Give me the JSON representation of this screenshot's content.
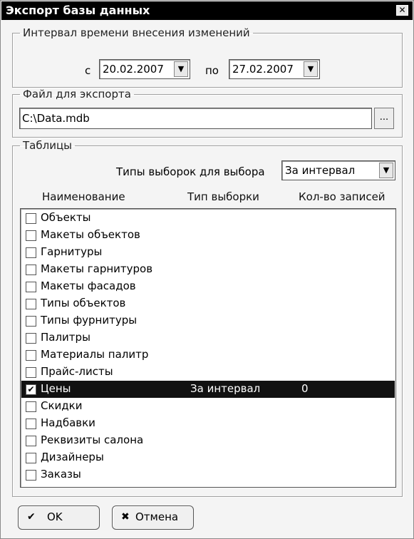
{
  "window": {
    "title": "Экспорт базы данных",
    "close_icon": "close-icon"
  },
  "interval": {
    "legend": "Интервал времени внесения изменений",
    "from_label": "с",
    "from_value": "20.02.2007",
    "to_label": "по",
    "to_value": "27.02.2007"
  },
  "export_file": {
    "legend": "Файл для экспорта",
    "path": "C:\\Data.mdb",
    "browse_label": "..."
  },
  "tables": {
    "legend": "Таблицы",
    "selection_type_label": "Типы выборок для выбора",
    "selection_type_value": "За интервал",
    "columns": [
      "Наименование",
      "Тип выборки",
      "Кол-во записей"
    ],
    "rows": [
      {
        "name": "Объекты",
        "checked": false,
        "type": "",
        "count": ""
      },
      {
        "name": "Макеты объектов",
        "checked": false,
        "type": "",
        "count": ""
      },
      {
        "name": "Гарнитуры",
        "checked": false,
        "type": "",
        "count": ""
      },
      {
        "name": "Макеты гарнитуров",
        "checked": false,
        "type": "",
        "count": ""
      },
      {
        "name": "Макеты фасадов",
        "checked": false,
        "type": "",
        "count": ""
      },
      {
        "name": "Типы объектов",
        "checked": false,
        "type": "",
        "count": ""
      },
      {
        "name": "Типы фурнитуры",
        "checked": false,
        "type": "",
        "count": ""
      },
      {
        "name": "Палитры",
        "checked": false,
        "type": "",
        "count": ""
      },
      {
        "name": "Материалы палитр",
        "checked": false,
        "type": "",
        "count": ""
      },
      {
        "name": "Прайс-листы",
        "checked": false,
        "type": "",
        "count": ""
      },
      {
        "name": "Цены",
        "checked": true,
        "type": "За интервал",
        "count": "0",
        "selected": true
      },
      {
        "name": "Скидки",
        "checked": false,
        "type": "",
        "count": ""
      },
      {
        "name": "Надбавки",
        "checked": false,
        "type": "",
        "count": ""
      },
      {
        "name": "Реквизиты салона",
        "checked": false,
        "type": "",
        "count": ""
      },
      {
        "name": "Дизайнеры",
        "checked": false,
        "type": "",
        "count": ""
      },
      {
        "name": "Заказы",
        "checked": false,
        "type": "",
        "count": ""
      }
    ]
  },
  "buttons": {
    "ok_label": "OK",
    "ok_icon": "checkmark-icon",
    "cancel_label": "Отмена",
    "cancel_icon": "cross-icon"
  },
  "colors": {
    "selection": "#111111",
    "titlebar": "#000000"
  }
}
